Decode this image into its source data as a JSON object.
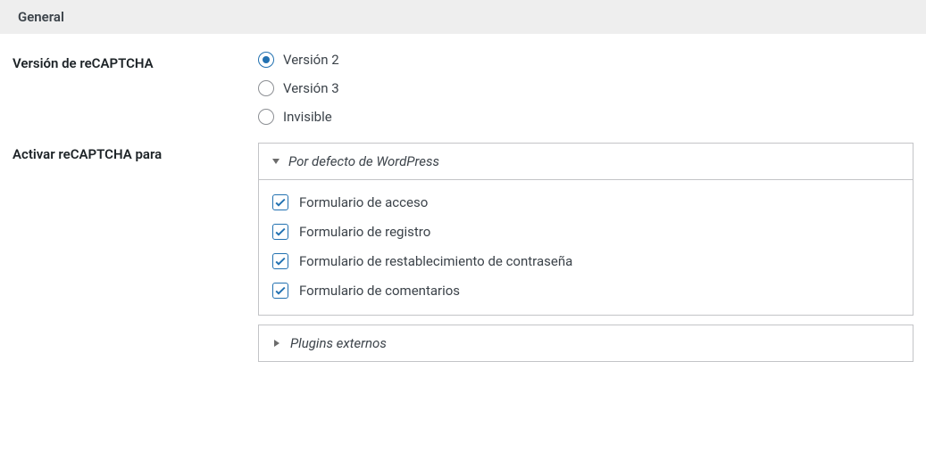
{
  "section": {
    "title": "General"
  },
  "version": {
    "label": "Versión de reCAPTCHA",
    "options": {
      "v2": "Versión 2",
      "v3": "Versión 3",
      "invisible": "Invisible"
    }
  },
  "enable": {
    "label": "Activar reCAPTCHA para",
    "panels": {
      "wp_default": {
        "title": "Por defecto de WordPress",
        "items": {
          "login": "Formulario de acceso",
          "register": "Formulario de registro",
          "reset": "Formulario de restablecimiento de contraseña",
          "comments": "Formulario de comentarios"
        }
      },
      "external": {
        "title": "Plugins externos"
      }
    }
  }
}
